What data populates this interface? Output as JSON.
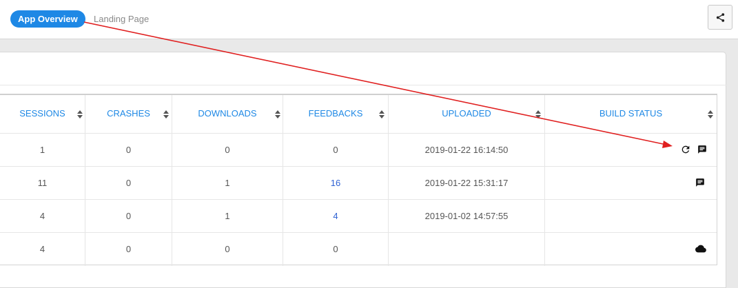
{
  "header": {
    "app_overview_label": "App Overview",
    "breadcrumb": "Landing Page",
    "share_icon": "share-icon"
  },
  "table": {
    "columns": [
      "SESSIONS",
      "CRASHES",
      "DOWNLOADS",
      "FEEDBACKS",
      "UPLOADED",
      "BUILD STATUS"
    ],
    "rows": [
      {
        "sessions": "1",
        "crashes": "0",
        "downloads": "0",
        "feedbacks": "0",
        "uploaded": "2019-01-22 16:14:50",
        "status_icons": [
          "refresh-icon",
          "comment-icon"
        ]
      },
      {
        "sessions": "11",
        "crashes": "0",
        "downloads": "1",
        "feedbacks": "16",
        "uploaded": "2019-01-22 15:31:17",
        "status_icons": [
          "comment-icon"
        ]
      },
      {
        "sessions": "4",
        "crashes": "0",
        "downloads": "1",
        "feedbacks": "4",
        "uploaded": "2019-01-02 14:57:55",
        "status_icons": []
      },
      {
        "sessions": "4",
        "crashes": "0",
        "downloads": "0",
        "feedbacks": "0",
        "uploaded": "",
        "status_icons": [
          "cloud-icon"
        ]
      }
    ]
  },
  "colors": {
    "accent": "#1e88e5",
    "link": "#2f62d3",
    "annotation_arrow": "#e02020"
  }
}
